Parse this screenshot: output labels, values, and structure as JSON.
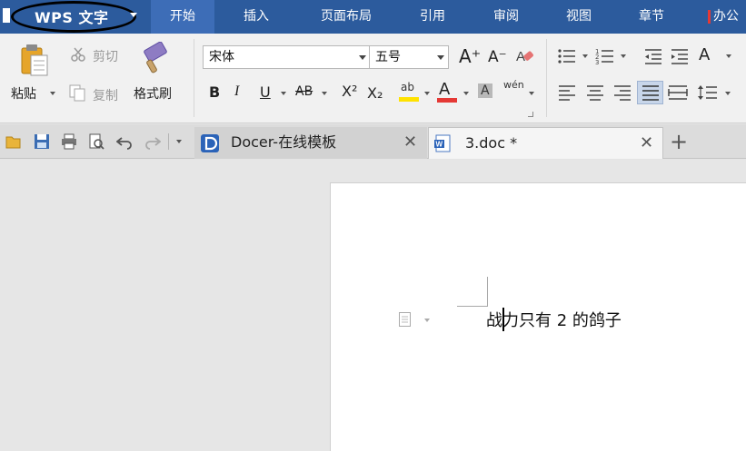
{
  "menubar": {
    "app_title": "WPS 文字",
    "tabs": [
      {
        "label": "开始",
        "active": true
      },
      {
        "label": "插入",
        "active": false
      },
      {
        "label": "页面布局",
        "active": false
      },
      {
        "label": "引用",
        "active": false
      },
      {
        "label": "审阅",
        "active": false
      },
      {
        "label": "视图",
        "active": false
      },
      {
        "label": "章节",
        "active": false
      }
    ],
    "office_label": "办公"
  },
  "ribbon": {
    "paste_label": "粘贴",
    "cut_label": "剪切",
    "copy_label": "复制",
    "format_painter_label": "格式刷",
    "font_name": "宋体",
    "font_size": "五号",
    "bold": "B",
    "italic": "I",
    "underline": "U",
    "strikethrough": "AB",
    "superscript": "X²",
    "subscript": "X₂",
    "highlight": "ab",
    "font_color": "A",
    "char_shading": "A",
    "phonetic": "wén",
    "grow_font": "A⁺",
    "shrink_font": "A⁻",
    "text_effects": "A"
  },
  "tabs": {
    "items": [
      {
        "label": "Docer-在线模板",
        "active": false
      },
      {
        "label": "3.doc *",
        "active": true
      }
    ],
    "new_tab": "+"
  },
  "document": {
    "text": "战力只有 2 的鸽子"
  },
  "colors": {
    "menubar": "#2c5b9d",
    "active_tab": "#3d6db7",
    "ribbon": "#f1f1f1",
    "workspace": "#e6e6e6",
    "page": "#ffffff",
    "highlight_yellow": "#ffe200",
    "font_red": "#e53935"
  }
}
